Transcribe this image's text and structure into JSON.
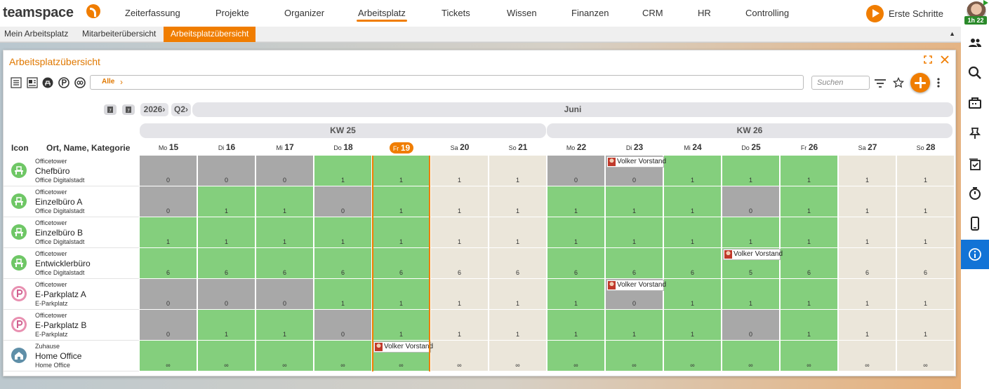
{
  "app": {
    "logo": "teamspace",
    "nav": [
      "Zeiterfassung",
      "Projekte",
      "Organizer",
      "Arbeitsplatz",
      "Tickets",
      "Wissen",
      "Finanzen",
      "CRM",
      "HR",
      "Controlling"
    ],
    "active_nav": "Arbeitsplatz",
    "erste_schritte": "Erste Schritte",
    "timer": "1h 22"
  },
  "subnav": {
    "tabs": [
      "Mein Arbeitsplatz",
      "Mitarbeiterübersicht",
      "Arbeitsplatzübersicht"
    ],
    "active": "Arbeitsplatzübersicht",
    "collapse_icon": "▲"
  },
  "rightbar_icons": [
    "users-icon",
    "search-icon",
    "inbox-icon",
    "pin-icon",
    "checklist-icon",
    "stopwatch-icon",
    "mobile-icon",
    "info-icon"
  ],
  "window": {
    "title": "Arbeitsplatzübersicht",
    "filter_chip": "Alle",
    "filter_chevron": "›",
    "search_placeholder": "Suchen"
  },
  "calendar": {
    "year": "2026›",
    "quarter": "Q2›",
    "month": "Juni",
    "weeks": [
      "KW 25",
      "KW 26"
    ],
    "col_icon": "Icon",
    "col_name": "Ort, Name, Kategorie",
    "days": [
      {
        "wd": "Mo",
        "d": "15"
      },
      {
        "wd": "Di",
        "d": "16"
      },
      {
        "wd": "Mi",
        "d": "17"
      },
      {
        "wd": "Do",
        "d": "18"
      },
      {
        "wd": "Fr",
        "d": "19"
      },
      {
        "wd": "Sa",
        "d": "20"
      },
      {
        "wd": "So",
        "d": "21"
      },
      {
        "wd": "Mo",
        "d": "22"
      },
      {
        "wd": "Di",
        "d": "23"
      },
      {
        "wd": "Mi",
        "d": "24"
      },
      {
        "wd": "Do",
        "d": "25"
      },
      {
        "wd": "Fr",
        "d": "26"
      },
      {
        "wd": "Sa",
        "d": "27"
      },
      {
        "wd": "So",
        "d": "28"
      }
    ],
    "today_index": 4
  },
  "rows": [
    {
      "loc": "Officetower",
      "name": "Chefbüro",
      "cat": "Office Digitalstadt",
      "type": "desk",
      "values": [
        "0",
        "0",
        "0",
        "1",
        "1",
        "1",
        "1",
        "0",
        "0",
        "1",
        "1",
        "1",
        "1",
        "1"
      ],
      "states": [
        "gray",
        "gray",
        "gray",
        "green",
        "green",
        "beige",
        "beige",
        "gray",
        "gray",
        "green",
        "green",
        "green",
        "beige",
        "beige"
      ]
    },
    {
      "loc": "Officetower",
      "name": "Einzelbüro A",
      "cat": "Office Digitalstadt",
      "type": "desk",
      "values": [
        "0",
        "1",
        "1",
        "0",
        "1",
        "1",
        "1",
        "1",
        "1",
        "1",
        "0",
        "1",
        "1",
        "1"
      ],
      "states": [
        "gray",
        "green",
        "green",
        "gray",
        "green",
        "beige",
        "beige",
        "green",
        "green",
        "green",
        "gray",
        "green",
        "beige",
        "beige"
      ]
    },
    {
      "loc": "Officetower",
      "name": "Einzelbüro B",
      "cat": "Office Digitalstadt",
      "type": "desk",
      "values": [
        "1",
        "1",
        "1",
        "1",
        "1",
        "1",
        "1",
        "1",
        "1",
        "1",
        "1",
        "1",
        "1",
        "1"
      ],
      "states": [
        "green",
        "green",
        "green",
        "green",
        "green",
        "beige",
        "beige",
        "green",
        "green",
        "green",
        "green",
        "green",
        "beige",
        "beige"
      ]
    },
    {
      "loc": "Officetower",
      "name": "Entwicklerbüro",
      "cat": "Office Digitalstadt",
      "type": "desk",
      "values": [
        "6",
        "6",
        "6",
        "6",
        "6",
        "6",
        "6",
        "6",
        "6",
        "6",
        "5",
        "6",
        "6",
        "6"
      ],
      "states": [
        "green",
        "green",
        "green",
        "green",
        "green",
        "beige",
        "beige",
        "green",
        "green",
        "green",
        "green",
        "green",
        "beige",
        "beige"
      ]
    },
    {
      "loc": "Officetower",
      "name": "E-Parkplatz A",
      "cat": "E-Parkplatz",
      "type": "parking",
      "values": [
        "0",
        "0",
        "0",
        "1",
        "1",
        "1",
        "1",
        "1",
        "0",
        "1",
        "1",
        "1",
        "1",
        "1"
      ],
      "states": [
        "gray",
        "gray",
        "gray",
        "green",
        "green",
        "beige",
        "beige",
        "green",
        "gray",
        "green",
        "green",
        "green",
        "beige",
        "beige"
      ]
    },
    {
      "loc": "Officetower",
      "name": "E-Parkplatz B",
      "cat": "E-Parkplatz",
      "type": "parking",
      "values": [
        "0",
        "1",
        "1",
        "0",
        "1",
        "1",
        "1",
        "1",
        "1",
        "1",
        "0",
        "1",
        "1",
        "1"
      ],
      "states": [
        "gray",
        "green",
        "green",
        "gray",
        "green",
        "beige",
        "beige",
        "green",
        "green",
        "green",
        "gray",
        "green",
        "beige",
        "beige"
      ]
    },
    {
      "loc": "Zuhause",
      "name": "Home Office",
      "cat": "Home Office",
      "type": "home",
      "values": [
        "∞",
        "∞",
        "∞",
        "∞",
        "∞",
        "∞",
        "∞",
        "∞",
        "∞",
        "∞",
        "∞",
        "∞",
        "∞",
        "∞"
      ],
      "states": [
        "green",
        "green",
        "green",
        "green",
        "green",
        "beige",
        "beige",
        "green",
        "green",
        "green",
        "green",
        "green",
        "beige",
        "beige"
      ]
    }
  ],
  "bookings": [
    {
      "row": 0,
      "day": 8,
      "label": "Volker Vorstand"
    },
    {
      "row": 3,
      "day": 10,
      "label": "Volker Vorstand"
    },
    {
      "row": 4,
      "day": 8,
      "label": "Volker Vorstand"
    },
    {
      "row": 6,
      "day": 4,
      "label": "Volker Vorstand"
    }
  ],
  "colors": {
    "accent": "#f07d00",
    "available": "#84cf7d",
    "occupied": "#a8a8a8",
    "weekend": "#ebe6da",
    "info_active": "#1273d6"
  }
}
